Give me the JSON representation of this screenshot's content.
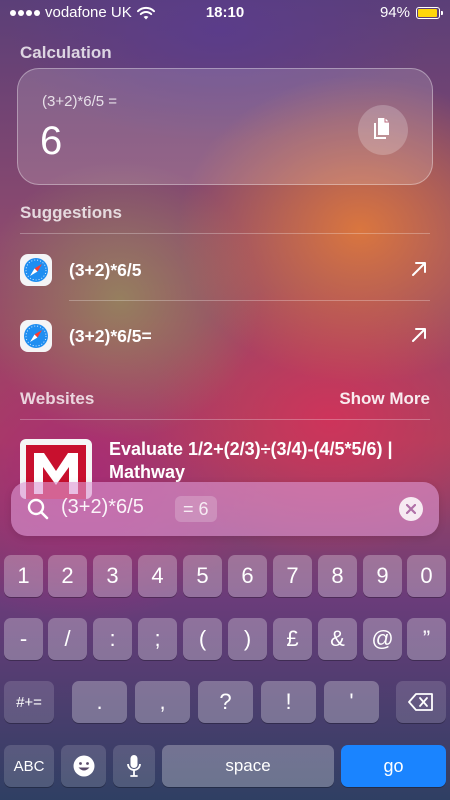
{
  "status_bar": {
    "carrier": "vodafone UK",
    "time": "18:10",
    "battery_percent": "94%",
    "battery_level": 0.94,
    "battery_color": "#ffd60a"
  },
  "calculation": {
    "title": "Calculation",
    "expression": "(3+2)*6/5 =",
    "result": "6",
    "copy_icon": "copy-icon"
  },
  "suggestions": {
    "title": "Suggestions",
    "items": [
      {
        "label": "(3+2)*6/5",
        "icon": "safari-icon"
      },
      {
        "label": "(3+2)*6/5=",
        "icon": "safari-icon"
      }
    ]
  },
  "websites": {
    "title": "Websites",
    "show_more": "Show More",
    "items": [
      {
        "title": "Evaluate 1/2+(2/3)÷(3/4)-(4/5*5/6) | Mathway",
        "logo_letter": "M",
        "logo_color": "#c8102e"
      }
    ]
  },
  "search": {
    "query": "(3+2)*6/5",
    "inline_result": "= 6"
  },
  "keyboard": {
    "row1": [
      "1",
      "2",
      "3",
      "4",
      "5",
      "6",
      "7",
      "8",
      "9",
      "0"
    ],
    "row2": [
      "-",
      "/",
      ":",
      ";",
      "(",
      ")",
      "£",
      "&",
      "@",
      "”"
    ],
    "row3": {
      "shift": "#+=",
      "keys": [
        ".",
        ",",
        "?",
        "!",
        "'"
      ]
    },
    "row4": {
      "abc": "ABC",
      "space": "space",
      "go": "go"
    },
    "accent_color": "#1a84ff"
  }
}
